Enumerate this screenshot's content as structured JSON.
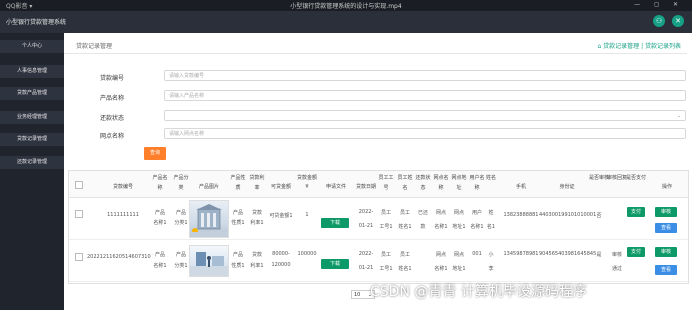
{
  "window": {
    "app_label": "QQ影音 ▾",
    "title": "小型银行贷款管理系统的设计与实现.mp4",
    "controls": "— ◻ ✕"
  },
  "header": {
    "system_name": "小型银行贷款管理系统",
    "icons": [
      "user-icon",
      "close-icon"
    ]
  },
  "sidebar": {
    "items": [
      {
        "label": "个人中心"
      },
      {
        "label": "人事信息管理"
      },
      {
        "label": "贷款产品管理"
      },
      {
        "label": "业务经理管理"
      },
      {
        "label": "贷款记录管理"
      },
      {
        "label": "还款记录管理"
      }
    ]
  },
  "page": {
    "title": "贷款记录管理",
    "breadcrumb": "贷款记录管理 | 贷款记录列表"
  },
  "filters": [
    {
      "label": "贷款编号",
      "placeholder": "请输入贷款编号"
    },
    {
      "label": "产品名称",
      "placeholder": "请输入产品名称"
    },
    {
      "label": "还款状态",
      "placeholder": ""
    },
    {
      "label": "网点名称",
      "placeholder": "请输入网点名称"
    }
  ],
  "search_label": "查询",
  "table": {
    "headers": {
      "loan_no": "贷款编号",
      "prod_name": [
        "产品名",
        "称"
      ],
      "prod_cat": [
        "产品分",
        "类"
      ],
      "prod_img": "产品图片",
      "prod_type": [
        "产品性",
        "质"
      ],
      "loan_term": [
        "贷款利",
        "率"
      ],
      "amount_range": "可贷金额",
      "loan_amt": [
        "贷款金额",
        "¥"
      ],
      "apply_file": "申请文件",
      "loan_date": "贷款日期",
      "emp_no": [
        "员工工",
        "号"
      ],
      "emp_name": [
        "员工姓",
        "名"
      ],
      "status": [
        "还款状",
        "态"
      ],
      "branch_name": [
        "网点名",
        "称"
      ],
      "branch_addr": [
        "网点地",
        "址"
      ],
      "user_acct": [
        "用户名",
        "称"
      ],
      "name": "姓名",
      "phone": "手机",
      "id_card": "身份证",
      "review": "是否审核",
      "audit_reply": "审核回复",
      "paid": "是否支付",
      "ops": "操作"
    },
    "rows": [
      {
        "loan_no": "1111111111",
        "prod_name": [
          "产品",
          "名称1"
        ],
        "prod_cat": [
          "产品",
          "分类1"
        ],
        "prod_type": [
          "产品",
          "性质1"
        ],
        "loan_term": [
          "贷款",
          "利率1"
        ],
        "amount_range": "可贷金额1",
        "loan_amt": "1",
        "download": "下载",
        "loan_date": [
          "2022-",
          "01-21"
        ],
        "emp_no": [
          "员工",
          "工号1"
        ],
        "emp_name": [
          "员工",
          "姓名1"
        ],
        "status": [
          "已还",
          "款"
        ],
        "branch_name": [
          "网点",
          "名称1"
        ],
        "branch_addr": [
          "网点",
          "地址1"
        ],
        "user_acct": [
          "用户",
          "名称1"
        ],
        "name": [
          "姓",
          "名1"
        ],
        "phone": "13823888881",
        "id_card": "440300199101010001",
        "review": "否",
        "audit_reply": "",
        "pay_btn": "支付",
        "ops": [
          "审核",
          "查看"
        ]
      },
      {
        "loan_no": "20221211620514607310 1",
        "prod_name": [
          "产品",
          "名称1"
        ],
        "prod_cat": [
          "产品",
          "分类1"
        ],
        "prod_type": [
          "产品",
          "性质1"
        ],
        "loan_term": [
          "贷款",
          "利率1"
        ],
        "amount_range": [
          "80000-",
          "120000"
        ],
        "loan_amt": "100000",
        "download": "下载",
        "loan_date": [
          "2022-",
          "01-21"
        ],
        "emp_no": [
          "员工",
          "工号1"
        ],
        "emp_name": [
          "员工",
          "姓名1"
        ],
        "status": "",
        "branch_name": [
          "网点",
          "名称1"
        ],
        "branch_addr": [
          "网点",
          "地址1"
        ],
        "user_acct": "001",
        "name": [
          "小",
          "李"
        ],
        "phone": "13459878981",
        "id_card": "904565403981645845",
        "review": "是",
        "audit_reply": [
          "审核",
          "通过"
        ],
        "pay_btn": "支付",
        "ops": [
          "审核",
          "查看"
        ]
      }
    ]
  },
  "pager": {
    "page_size": "10"
  },
  "watermark": "CSDN @青青 计算机毕设源码程序"
}
